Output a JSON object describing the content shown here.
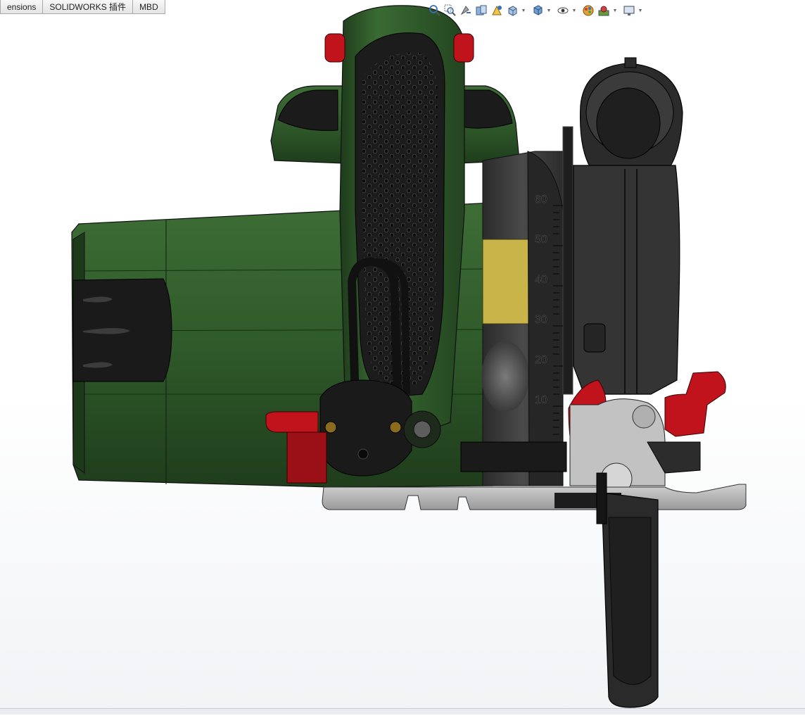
{
  "cmd_tabs": [
    {
      "id": "dimensions",
      "label": "ensions"
    },
    {
      "id": "addins",
      "label": "SOLIDWORKS 插件"
    },
    {
      "id": "mbd",
      "label": "MBD"
    }
  ],
  "heads_up_toolbar": [
    {
      "name": "zoom-to-fit-icon",
      "dropdown": false
    },
    {
      "name": "zoom-to-area-icon",
      "dropdown": false
    },
    {
      "name": "previous-view-icon",
      "dropdown": false
    },
    {
      "name": "section-view-icon",
      "dropdown": false
    },
    {
      "name": "dynamic-annotation-icon",
      "dropdown": false
    },
    {
      "name": "view-orientation-icon",
      "dropdown": true
    },
    {
      "name": "display-style-icon",
      "dropdown": true
    },
    {
      "name": "hide-show-items-icon",
      "dropdown": true
    },
    {
      "name": "edit-appearance-icon",
      "dropdown": false
    },
    {
      "name": "apply-scene-icon",
      "dropdown": true
    },
    {
      "name": "view-settings-icon",
      "dropdown": true
    }
  ],
  "model": {
    "type": "circular-saw-side-view",
    "depth_scale_labels": [
      "60",
      "50",
      "40",
      "30",
      "20",
      "10"
    ],
    "colors": {
      "body_green": "#2f5a2a",
      "body_green_dark": "#1f3d1c",
      "grip_black": "#1c1c1c",
      "housing_gray": "#3a3a3a",
      "baseplate_gray": "#b9b9b9",
      "red_knob": "#c0131b",
      "yellow_label": "#c9b44a",
      "background": "#ffffff"
    }
  }
}
